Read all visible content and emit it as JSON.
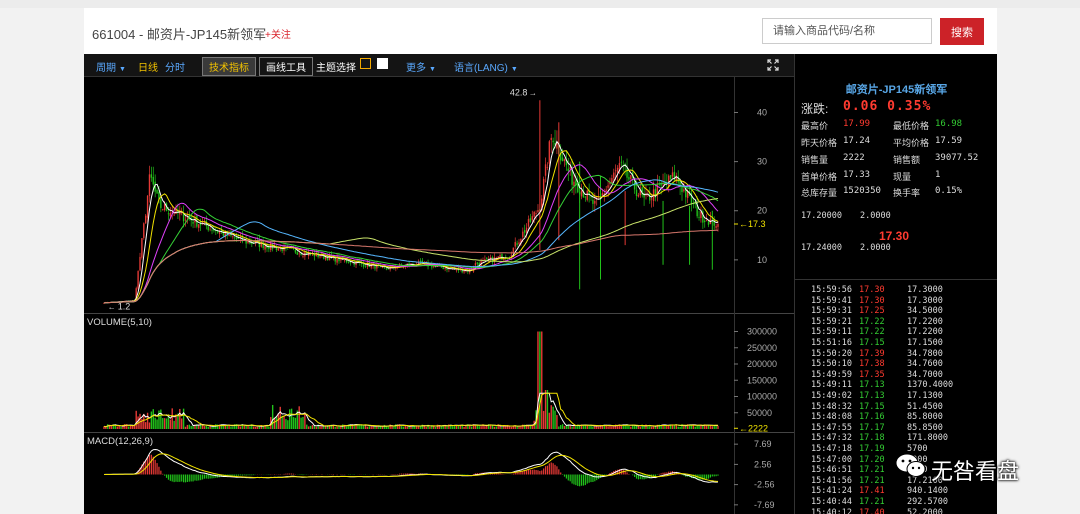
{
  "header": {
    "title": "661004 - 邮资片-JP145新领军",
    "follow_label": "+关注",
    "search_placeholder": "请输入商品代码/名称",
    "search_button": "搜索"
  },
  "toolbar": {
    "items": [
      {
        "label": "周期",
        "color": "#5aa9ff",
        "caret": true
      },
      {
        "label": "日线",
        "color": "#f2c200"
      },
      {
        "label": "分时",
        "color": "#5aa9ff"
      },
      {
        "label": "技术指标",
        "color": "#f2c200",
        "active": true
      },
      {
        "label": "画线工具",
        "color": "#ffffff",
        "boxed": true
      },
      {
        "label": "主题选择",
        "color": "#ffffff"
      },
      {
        "label": "更多",
        "color": "#5aa9ff",
        "caret": true
      },
      {
        "label": "语言(LANG)",
        "color": "#5aa9ff",
        "caret": true
      }
    ],
    "theme_colors": [
      "#f2a900",
      "#ffffff"
    ]
  },
  "chart_data": [
    {
      "type": "candlestick",
      "panel": "price",
      "y_ticks": [
        40,
        30,
        20,
        10
      ],
      "ylim": [
        0,
        46
      ],
      "high_label": "42.8",
      "low_label": "1.2",
      "current_label": "17.3"
    },
    {
      "type": "bar",
      "panel": "volume",
      "title": "VOLUME(5,10)",
      "y_ticks": [
        "300000",
        "250000",
        "200000",
        "150000",
        "100000",
        "50000"
      ],
      "ylim": [
        0,
        320000
      ],
      "current_label": "2222"
    },
    {
      "type": "bar",
      "panel": "macd",
      "title": "MACD(12,26,9)",
      "y_ticks": [
        "7.69",
        "2.56",
        "-2.56",
        "-7.69"
      ],
      "ylim": [
        -9,
        9
      ]
    }
  ],
  "quote": {
    "name": "邮资片-JP145新领军",
    "change_label": "涨跌:",
    "change_value": "0.06 0.35%",
    "fields": [
      {
        "label": "最高价",
        "value": "17.99",
        "color": "#ff3b30"
      },
      {
        "label": "最低价格",
        "value": "16.98",
        "color": "#33cc33"
      },
      {
        "label": "昨天价格",
        "value": "17.24",
        "color": "#dddddd"
      },
      {
        "label": "平均价格",
        "value": "17.59",
        "color": "#dddddd"
      },
      {
        "label": "销售量",
        "value": "2222",
        "color": "#dddddd"
      },
      {
        "label": "销售额",
        "value": "39077.52",
        "color": "#dddddd"
      },
      {
        "label": "首单价格",
        "value": "17.33",
        "color": "#dddddd"
      },
      {
        "label": "现量",
        "value": "1",
        "color": "#dddddd"
      },
      {
        "label": "总库存量",
        "value": "1520350",
        "color": "#dddddd"
      },
      {
        "label": "换手率",
        "value": "0.15%",
        "color": "#dddddd"
      }
    ],
    "ask": {
      "price": "17.20000",
      "qty": "2.0000"
    },
    "last": "17.30",
    "bid": {
      "price": "17.24000",
      "qty": "2.0000"
    }
  },
  "ticks": [
    {
      "time": "15:59:56",
      "price": "17.30",
      "dir": "up",
      "qty": "17.3000"
    },
    {
      "time": "15:59:41",
      "price": "17.30",
      "dir": "up",
      "qty": "17.3000"
    },
    {
      "time": "15:59:31",
      "price": "17.25",
      "dir": "up",
      "qty": "34.5000"
    },
    {
      "time": "15:59:21",
      "price": "17.22",
      "dir": "down",
      "qty": "17.2200"
    },
    {
      "time": "15:59:11",
      "price": "17.22",
      "dir": "down",
      "qty": "17.2200"
    },
    {
      "time": "15:51:16",
      "price": "17.15",
      "dir": "down",
      "qty": "17.1500"
    },
    {
      "time": "15:50:20",
      "price": "17.39",
      "dir": "up",
      "qty": "34.7800"
    },
    {
      "time": "15:50:10",
      "price": "17.38",
      "dir": "up",
      "qty": "34.7600"
    },
    {
      "time": "15:49:59",
      "price": "17.35",
      "dir": "up",
      "qty": "34.7000"
    },
    {
      "time": "15:49:11",
      "price": "17.13",
      "dir": "down",
      "qty": "1370.4000"
    },
    {
      "time": "15:49:02",
      "price": "17.13",
      "dir": "down",
      "qty": "17.1300"
    },
    {
      "time": "15:48:32",
      "price": "17.15",
      "dir": "down",
      "qty": "51.4500"
    },
    {
      "time": "15:48:08",
      "price": "17.16",
      "dir": "down",
      "qty": "85.8000"
    },
    {
      "time": "15:47:55",
      "price": "17.17",
      "dir": "down",
      "qty": "85.8500"
    },
    {
      "time": "15:47:32",
      "price": "17.18",
      "dir": "down",
      "qty": "171.8000"
    },
    {
      "time": "15:47:18",
      "price": "17.19",
      "dir": "down",
      "qty": "5700"
    },
    {
      "time": "15:47:00",
      "price": "17.20",
      "dir": "down",
      "qty": "3000"
    },
    {
      "time": "15:46:51",
      "price": "17.21",
      "dir": "down",
      "qty": "2100"
    },
    {
      "time": "15:41:56",
      "price": "17.21",
      "dir": "down",
      "qty": "17.2100"
    },
    {
      "time": "15:41:24",
      "price": "17.41",
      "dir": "up",
      "qty": "940.1400"
    },
    {
      "time": "15:40:44",
      "price": "17.21",
      "dir": "down",
      "qty": "292.5700"
    },
    {
      "time": "15:40:12",
      "price": "17.40",
      "dir": "up",
      "qty": "52.2000"
    }
  ],
  "watermark": {
    "text": "无咎看盘"
  }
}
